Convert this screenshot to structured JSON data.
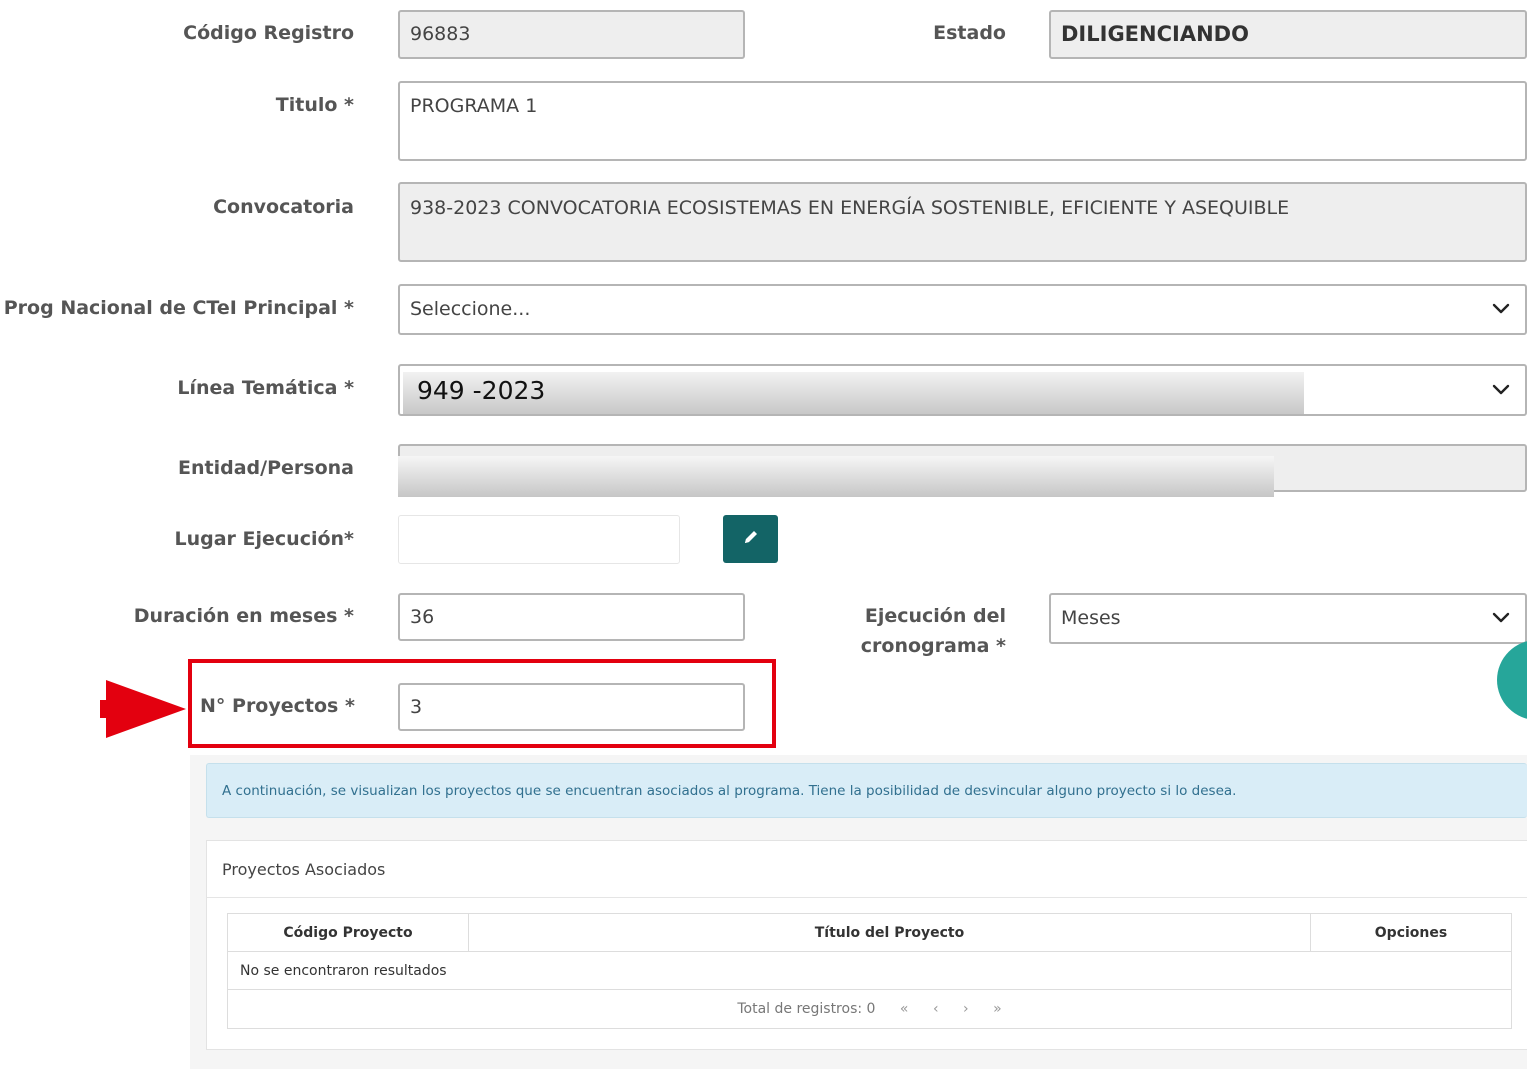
{
  "form": {
    "codigo_registro": {
      "label": "Código Registro",
      "value": "96883"
    },
    "estado": {
      "label": "Estado",
      "value": "DILIGENCIANDO"
    },
    "titulo": {
      "label": "Titulo *",
      "value": "PROGRAMA 1"
    },
    "convocatoria": {
      "label": "Convocatoria",
      "value": "938-2023 CONVOCATORIA ECOSISTEMAS EN ENERGÍA SOSTENIBLE, EFICIENTE Y ASEQUIBLE"
    },
    "prog_nacional": {
      "label": "Prog Nacional de CTeI Principal  *",
      "value": "Seleccione..."
    },
    "linea_tematica": {
      "label": "Línea Temática *",
      "value": "949 -2023"
    },
    "entidad_persona": {
      "label": "Entidad/Persona",
      "value": ""
    },
    "lugar_ejecucion": {
      "label": "Lugar Ejecución*",
      "value": ""
    },
    "duracion_meses": {
      "label": "Duración en meses *",
      "value": "36"
    },
    "ejecucion_cronograma": {
      "label_line1": "Ejecución del",
      "label_line2": "cronograma  *",
      "value": "Meses"
    },
    "n_proyectos": {
      "label": "N° Proyectos *",
      "value": "3"
    }
  },
  "alert_text": "A continuación, se visualizan los proyectos que se encuentran asociados al programa. Tiene la posibilidad de desvincular alguno proyecto si lo desea.",
  "proyectos": {
    "title": "Proyectos Asociados",
    "columns": [
      "Código Proyecto",
      "Título del Proyecto",
      "Opciones"
    ],
    "empty_text": "No se encontraron resultados",
    "total_text": "Total de registros: 0",
    "pager": {
      "first": "«",
      "prev": "‹",
      "next": "›",
      "last": "»"
    }
  },
  "icons": {
    "edit": "pencil-icon",
    "dropdown": "chevron-down-icon",
    "annotation_arrow": "arrow-right-icon"
  },
  "colors": {
    "edit_button": "#136466",
    "highlight": "#e3000f",
    "alert_bg": "#d9edf7",
    "fab": "#26a69a"
  }
}
